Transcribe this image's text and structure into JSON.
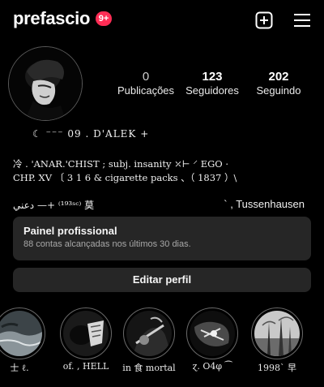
{
  "header": {
    "username": "prefascio",
    "notification_count": "9+",
    "create_icon": "plus-square-icon",
    "menu_icon": "hamburger-menu-icon"
  },
  "profile": {
    "avatar_icon": "profile-photo",
    "stats": [
      {
        "value": "0",
        "label": "Publicações"
      },
      {
        "value": "123",
        "label": "Seguidores"
      },
      {
        "value": "202",
        "label": "Seguindo"
      }
    ]
  },
  "bio": {
    "line1": "☾  ⁻⁻⁻   09 .   D'ALEK   +",
    "line2": "冷 . 'ANAR.'CHIST ;  subj. insanity  ⤫⊢  ⸍ EGO ·",
    "line3": "CHP. XV 〔 3 1 6 & cigarette packs 、（ 1837 ）\\",
    "line4_left": "دعني    —+    ⁽¹⁹³ˢᶜ⁾     莫",
    "line4_right": "` , Tussenhausen"
  },
  "professional_dashboard": {
    "title": "Painel profissional",
    "subtitle": "88 contas alcançadas nos últimos 30 dias."
  },
  "edit_profile_button": "Editar perfil",
  "highlights": [
    {
      "label": "士 ℓ.",
      "icon": "story-highlight-1"
    },
    {
      "label": "of. , HELL",
      "icon": "story-highlight-2"
    },
    {
      "label": "in 食 mortal",
      "icon": "story-highlight-3"
    },
    {
      "label": "ɀ. O4φ ⁀",
      "icon": "story-highlight-4"
    },
    {
      "label": "1998` 早",
      "icon": "story-highlight-5"
    }
  ],
  "colors": {
    "background": "#000000",
    "badge": "#ff2d55",
    "panel": "#262626",
    "secondary_text": "#a8a8a8"
  }
}
